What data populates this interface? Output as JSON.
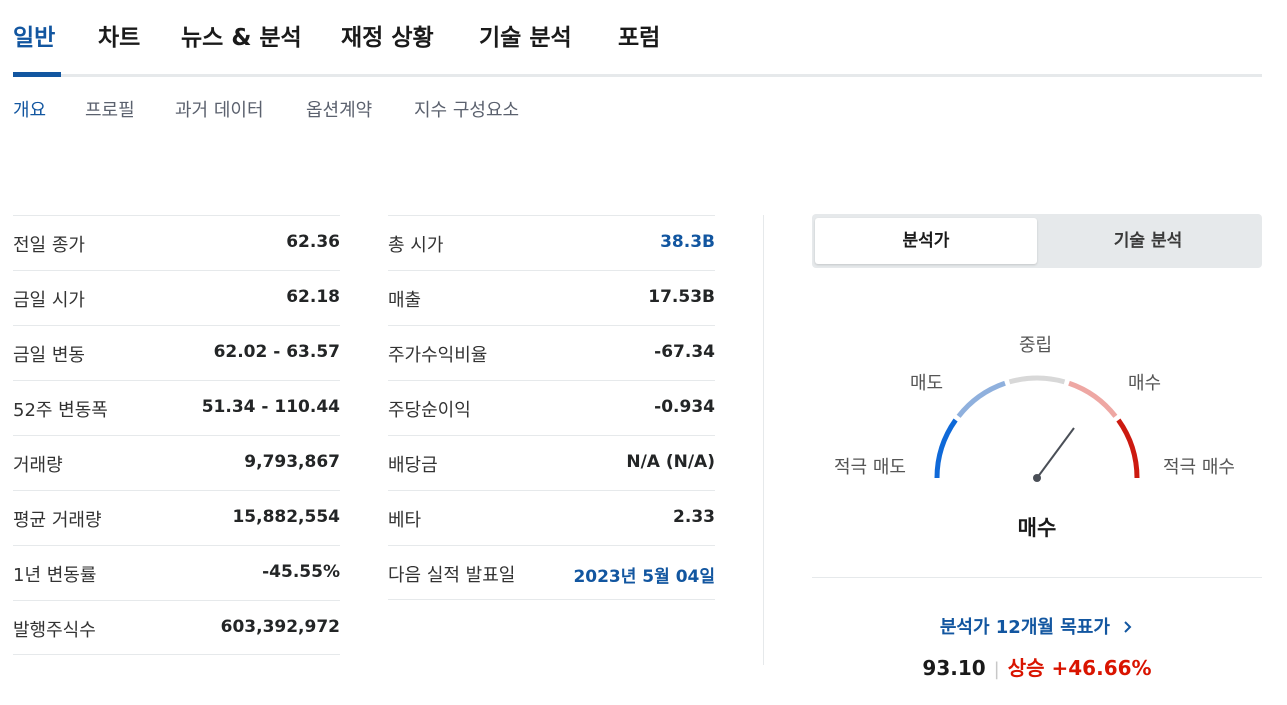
{
  "main_tabs": [
    "일반",
    "차트",
    "뉴스 & 분석",
    "재정 상황",
    "기술 분석",
    "포럼"
  ],
  "sub_tabs": [
    "개요",
    "프로필",
    "과거 데이터",
    "옵션계약",
    "지수 구성요소"
  ],
  "stats_left": [
    {
      "label": "전일 종가",
      "value": "62.36"
    },
    {
      "label": "금일 시가",
      "value": "62.18"
    },
    {
      "label": "금일 변동",
      "value": "62.02 - 63.57"
    },
    {
      "label": "52주 변동폭",
      "value": "51.34 - 110.44"
    },
    {
      "label": "거래량",
      "value": "9,793,867"
    },
    {
      "label": "평균 거래량",
      "value": "15,882,554"
    },
    {
      "label": "1년 변동률",
      "value": "-45.55%"
    },
    {
      "label": "발행주식수",
      "value": "603,392,972"
    }
  ],
  "stats_right": [
    {
      "label": "총 시가",
      "value": "38.3B"
    },
    {
      "label": "매출",
      "value": "17.53B"
    },
    {
      "label": "주가수익비율",
      "value": "-67.34"
    },
    {
      "label": "주당순이익",
      "value": "-0.934"
    },
    {
      "label": "배당금",
      "value": "N/A (N/A)"
    },
    {
      "label": "베타",
      "value": "2.33"
    },
    {
      "label": "다음 실적 발표일",
      "value": "2023년 5월 04일"
    }
  ],
  "analysis_toggle": {
    "active": "분석가",
    "inactive": "기술 분석"
  },
  "gauge": {
    "labels": {
      "strong_sell": "적극 매도",
      "sell": "매도",
      "neutral": "중립",
      "buy": "매수",
      "strong_buy": "적극 매수"
    },
    "result": "매수",
    "colors": {
      "strong_sell": "#0f69d8",
      "sell": "#8fb0dd",
      "neutral": "#d8d8d8",
      "buy": "#eea7a3",
      "strong_buy": "#cc1a10",
      "needle": "#4a4f57"
    }
  },
  "target": {
    "link_label": "분석가 12개월 목표가",
    "chevron": "chevron-right-icon",
    "price": "93.10",
    "separator": "|",
    "change": "상승 +46.66%"
  },
  "colors": {
    "accent": "#1256a0",
    "negative": "#d91400",
    "divider": "#e6e9eb"
  }
}
